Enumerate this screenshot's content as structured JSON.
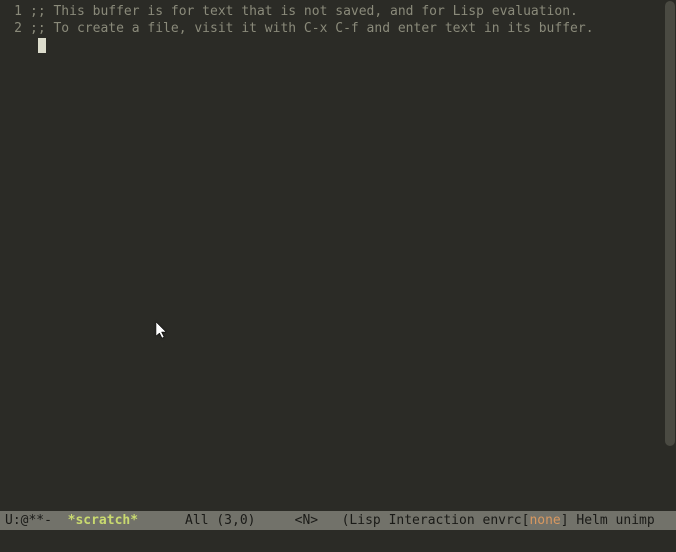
{
  "buffer": {
    "lines": [
      {
        "num": "1",
        "text": ";; This buffer is for text that is not saved, and for Lisp evaluation."
      },
      {
        "num": "2",
        "text": ";; To create a file, visit it with C-x C-f and enter text in its buffer."
      }
    ]
  },
  "modeline": {
    "status": "U:@**-  ",
    "buffer_name": "*scratch*",
    "spacing1": "      ",
    "position": "All (3,0)",
    "spacing2": "     ",
    "vim_mode": "<N>",
    "spacing3": "   ",
    "modes_prefix": "(Lisp Interaction envrc[",
    "envrc_value": "none",
    "modes_suffix": "] Helm unimp"
  }
}
